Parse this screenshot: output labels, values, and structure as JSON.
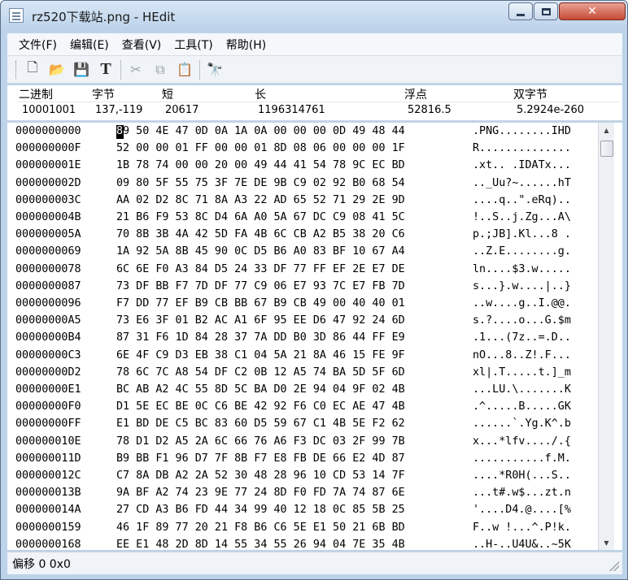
{
  "window": {
    "title": "rz520下载站.png - HEdit",
    "close_glyph": "✕"
  },
  "menu": [
    "文件(F)",
    "编辑(E)",
    "查看(V)",
    "工具(T)",
    "帮助(H)"
  ],
  "toolbar": [
    {
      "icon": "new-file-icon",
      "glyph": "🗋",
      "enabled": true
    },
    {
      "icon": "open-folder-icon",
      "glyph": "📂",
      "enabled": true
    },
    {
      "icon": "save-icon",
      "glyph": "💾",
      "enabled": false
    },
    {
      "icon": "text-mode-icon",
      "glyph": "T",
      "enabled": true
    },
    {
      "icon": "cut-icon",
      "glyph": "✂",
      "enabled": false
    },
    {
      "icon": "copy-icon",
      "glyph": "⧉",
      "enabled": false
    },
    {
      "icon": "paste-icon",
      "glyph": "📋",
      "enabled": true
    },
    {
      "icon": "find-binoculars-icon",
      "glyph": "🔭",
      "enabled": true
    }
  ],
  "info": {
    "binary": {
      "label": "二进制",
      "value": "10001001"
    },
    "byte": {
      "label": "字节",
      "value": "137,-119"
    },
    "short": {
      "label": "短",
      "value": "20617"
    },
    "long": {
      "label": "长",
      "value": "1196314761"
    },
    "float": {
      "label": "浮点",
      "value": "52816.5"
    },
    "double": {
      "label": "双字节",
      "value": "5.2924e-260"
    }
  },
  "hex": {
    "cursor_char": "8",
    "rows": [
      {
        "off": "0000000000",
        "hex": "89 50 4E 47 0D 0A 1A 0A 00 00 00 0D 49 48 44",
        "ascii": ".PNG........IHD"
      },
      {
        "off": "000000000F",
        "hex": "52 00 00 01 FF 00 00 01 8D 08 06 00 00 00 1F",
        "ascii": "R.............."
      },
      {
        "off": "000000001E",
        "hex": "1B 78 74 00 00 20 00 49 44 41 54 78 9C EC BD",
        "ascii": ".xt.. .IDATx..."
      },
      {
        "off": "000000002D",
        "hex": "09 80 5F 55 75 3F 7E DE 9B C9 02 92 B0 68 54",
        "ascii": ".._Uu?~......hT"
      },
      {
        "off": "000000003C",
        "hex": "AA 02 D2 8C 71 8A A3 22 AD 65 52 71 29 2E 9D",
        "ascii": "....q..\".eRq).."
      },
      {
        "off": "000000004B",
        "hex": "21 B6 F9 53 8C D4 6A A0 5A 67 DC C9 08 41 5C",
        "ascii": "!..S..j.Zg...A\\"
      },
      {
        "off": "000000005A",
        "hex": "70 8B 3B 4A 42 5D FA 4B 6C CB A2 B5 38 20 C6",
        "ascii": "p.;JB].Kl...8 ."
      },
      {
        "off": "0000000069",
        "hex": "1A 92 5A 8B 45 90 0C D5 B6 A0 83 BF 10 67 A4",
        "ascii": "..Z.E........g."
      },
      {
        "off": "0000000078",
        "hex": "6C 6E F0 A3 84 D5 24 33 DF 77 FF EF 2E E7 DE",
        "ascii": "ln....$3.w....."
      },
      {
        "off": "0000000087",
        "hex": "73 DF BB F7 7D DF 77 C9 06 E7 93 7C E7 FB 7D",
        "ascii": "s...}.w....|..}"
      },
      {
        "off": "0000000096",
        "hex": "F7 DD 77 EF B9 CB BB 67 B9 CB 49 00 40 40 01",
        "ascii": "..w....g..I.@@."
      },
      {
        "off": "00000000A5",
        "hex": "73 E6 3F 01 B2 AC A1 6F 95 EE D6 47 92 24 6D",
        "ascii": "s.?....o...G.$m"
      },
      {
        "off": "00000000B4",
        "hex": "87 31 F6 1D 84 28 37 7A DD B0 3D 86 44 FF E9",
        "ascii": ".1...(7z..=.D.."
      },
      {
        "off": "00000000C3",
        "hex": "6E 4F C9 D3 EB 38 C1 04 5A 21 8A 46 15 FE 9F",
        "ascii": "nO...8..Z!.F..."
      },
      {
        "off": "00000000D2",
        "hex": "78 6C 7C A8 54 DF C2 0B 12 A5 74 BA 5D 5F 6D",
        "ascii": "xl|.T.....t.]_m"
      },
      {
        "off": "00000000E1",
        "hex": "BC AB A2 4C 55 8D 5C BA D0 2E 94 04 9F 02 4B",
        "ascii": "...LU.\\.......K"
      },
      {
        "off": "00000000F0",
        "hex": "D1 5E EC BE 0C C6 BE 42 92 F6 C0 EC AE 47 4B",
        "ascii": ".^.....B.....GK"
      },
      {
        "off": "00000000FF",
        "hex": "E1 BD DE C5 BC 83 60 D5 59 67 C1 4B 5E F2 62",
        "ascii": "......`.Yg.K^.b"
      },
      {
        "off": "000000010E",
        "hex": "78 D1 D2 A5 2A 6C 66 76 A6 F3 DC 03 2F 99 7B",
        "ascii": "x...*lfv..../.{"
      },
      {
        "off": "000000011D",
        "hex": "B9 BB F1 96 D7 7F 8B F7 E8 FB DE 66 E2 4D 87",
        "ascii": "...........f.M."
      },
      {
        "off": "000000012C",
        "hex": "C7 8A DB A2 2A 52 30 48 28 96 10 CD 53 14 7F",
        "ascii": "....*R0H(...S.."
      },
      {
        "off": "000000013B",
        "hex": "9A BF A2 74 23 9E 77 24 8D F0 FD 7A 74 87 6E",
        "ascii": "...t#.w$...zt.n"
      },
      {
        "off": "000000014A",
        "hex": "27 CD A3 B6 FD 44 34 99 40 12 18 0C 85 5B 25",
        "ascii": "'....D4.@....[%"
      },
      {
        "off": "0000000159",
        "hex": "46 1F 89 77 20 21 F8 B6 C6 5E E1 50 21 6B BD",
        "ascii": "F..w !...^.P!k."
      },
      {
        "off": "0000000168",
        "hex": "EE E1 48 2D 8D 14 55 34 55 26 94 04 7E 35 4B",
        "ascii": "..H-..U4U&..~5K"
      }
    ]
  },
  "status": "偏移 0 0x0"
}
